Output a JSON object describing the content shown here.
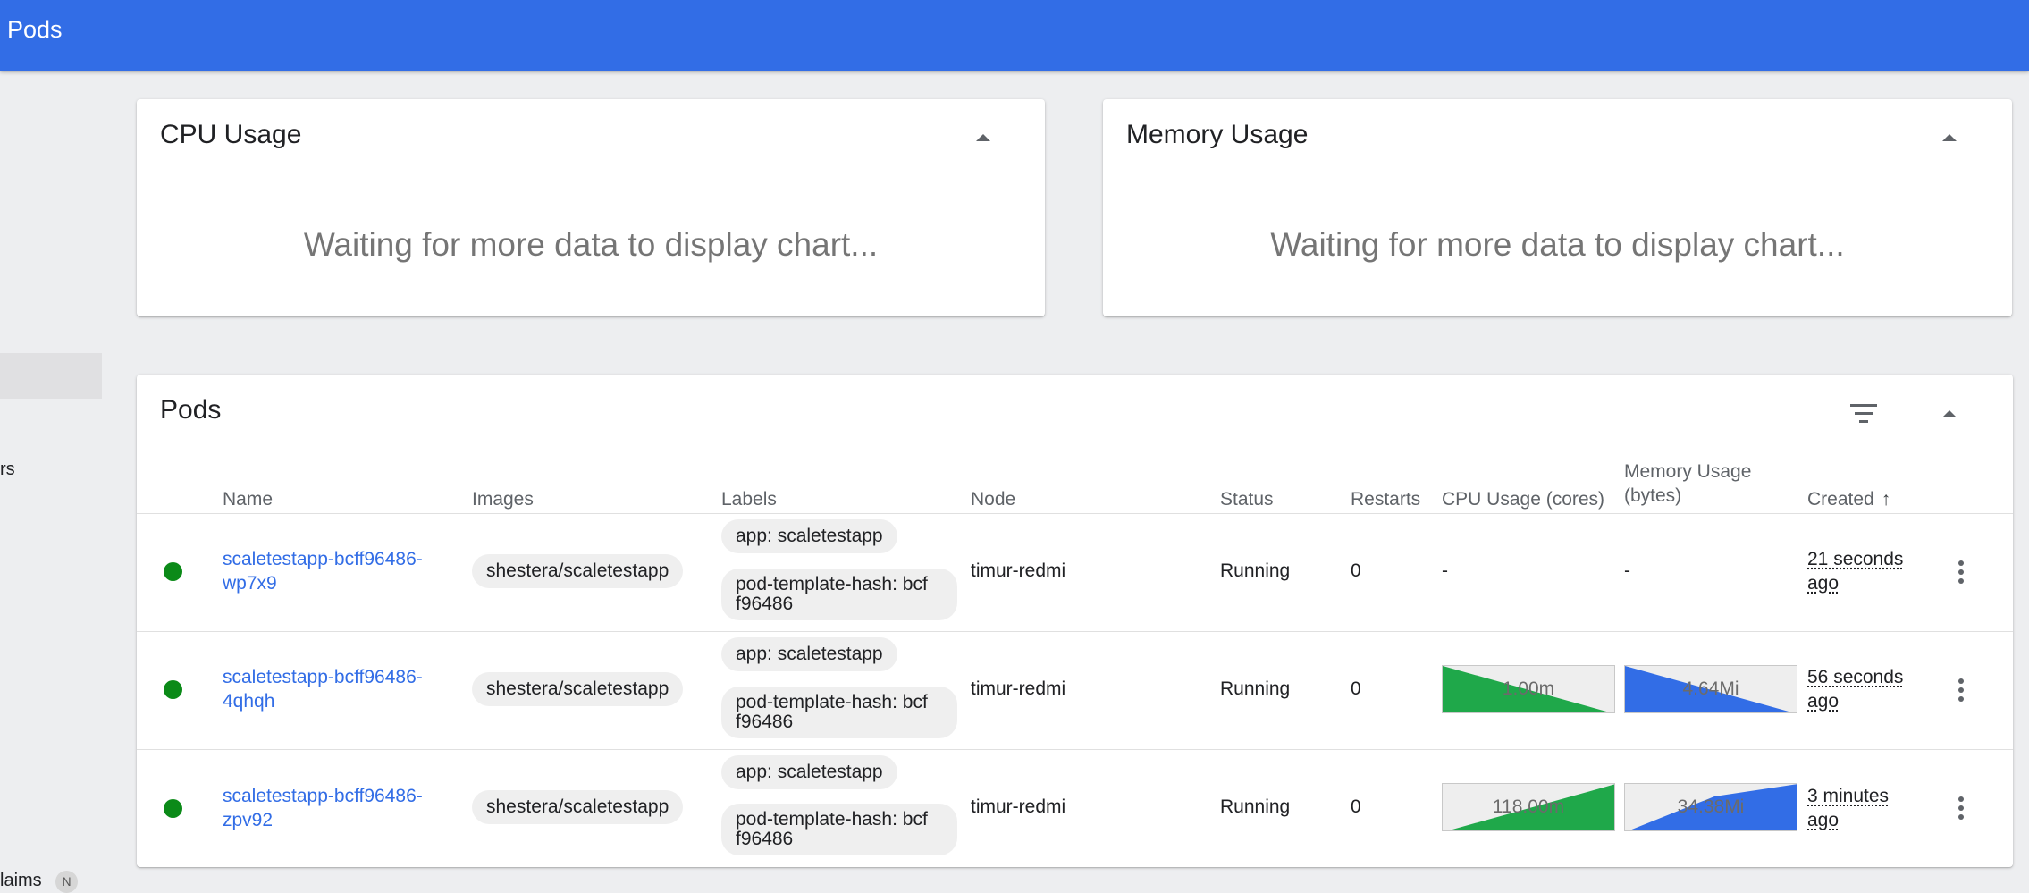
{
  "header": {
    "title": "Pods"
  },
  "sidebar": {
    "partial_items": [
      {
        "label": "rs",
        "top": 0
      },
      {
        "label": "laims",
        "badge": "N"
      }
    ]
  },
  "cpu_card": {
    "title": "CPU Usage",
    "message": "Waiting for more data to display chart..."
  },
  "memory_card": {
    "title": "Memory Usage",
    "message": "Waiting for more data to display chart..."
  },
  "pods_card": {
    "title": "Pods",
    "columns": {
      "name": "Name",
      "images": "Images",
      "labels": "Labels",
      "node": "Node",
      "status": "Status",
      "restarts": "Restarts",
      "cpu": "CPU Usage (cores)",
      "memory_line1": "Memory Usage",
      "memory_line2": "(bytes)",
      "created": "Created",
      "created_sort": "↑"
    },
    "rows": [
      {
        "name_line1": "scaletestapp-bcff96486-",
        "name_line2": "wp7x9",
        "image": "shestera/scaletestapp",
        "label_app": "app: scaletestapp",
        "label_hash_line1": "pod-template-hash: bcf",
        "label_hash_line2": "f96486",
        "node": "timur-redmi",
        "status": "Running",
        "restarts": "0",
        "cpu": "-",
        "memory": "-",
        "created_line1": "21 seconds",
        "created_line2": "ago"
      },
      {
        "name_line1": "scaletestapp-bcff96486-",
        "name_line2": "4qhqh",
        "image": "shestera/scaletestapp",
        "label_app": "app: scaletestapp",
        "label_hash_line1": "pod-template-hash: bcf",
        "label_hash_line2": "f96486",
        "node": "timur-redmi",
        "status": "Running",
        "restarts": "0",
        "cpu": "1.00m",
        "memory": "4.64Mi",
        "created_line1": "56 seconds",
        "created_line2": "ago"
      },
      {
        "name_line1": "scaletestapp-bcff96486-",
        "name_line2": "zpv92",
        "image": "shestera/scaletestapp",
        "label_app": "app: scaletestapp",
        "label_hash_line1": "pod-template-hash: bcf",
        "label_hash_line2": "f96486",
        "node": "timur-redmi",
        "status": "Running",
        "restarts": "0",
        "cpu": "118.00m",
        "memory": "34.38Mi",
        "created_line1": "3 minutes",
        "created_line2": "ago"
      }
    ]
  },
  "colors": {
    "header": "#326de6",
    "link": "#326de6",
    "running": "#0b8a18",
    "cpu_spark": "#1fa84a",
    "memory_spark": "#326de6"
  },
  "icons": [
    "filter-icon",
    "collapse-caret-icon",
    "more-vert-icon",
    "status-running-icon"
  ]
}
